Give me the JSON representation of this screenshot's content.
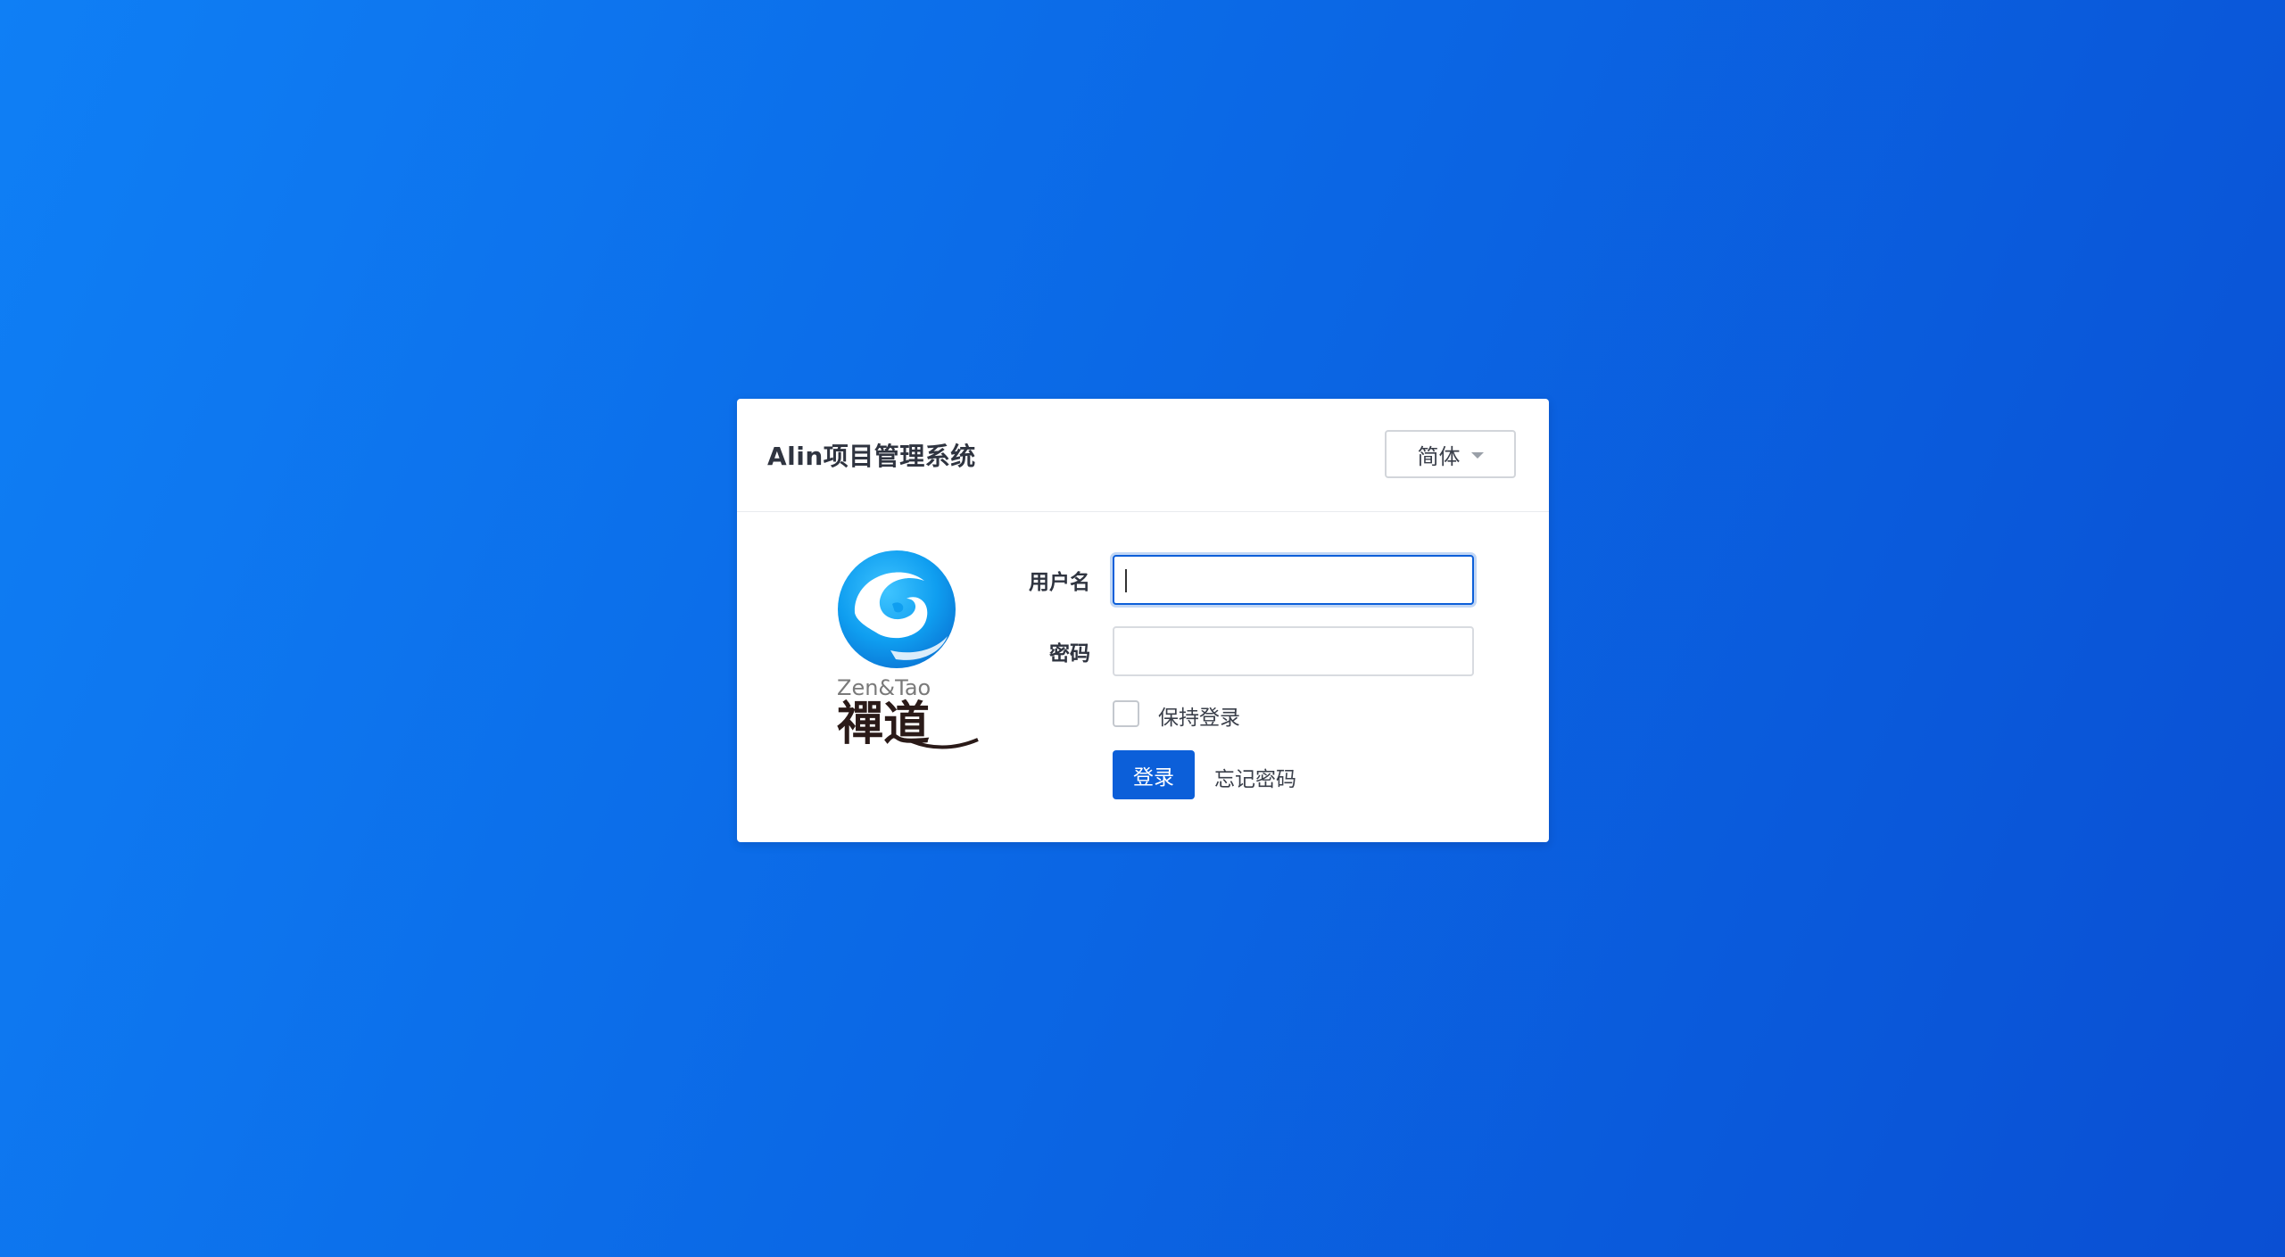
{
  "login_panel": {
    "title": "Alin项目管理系统",
    "language_selector": {
      "selected": "简体",
      "icon": "caret-down-icon"
    },
    "logo": {
      "text_latin": "Zen&Tao",
      "text_chinese": "禪道"
    },
    "username": {
      "label": "用户名",
      "value": "",
      "focused": true
    },
    "password": {
      "label": "密码",
      "value": ""
    },
    "keep_login": {
      "label": "保持登录",
      "checked": false
    },
    "login_button": "登录",
    "forgot_password": "忘记密码"
  },
  "colors": {
    "background_start": "#0f7ff5",
    "background_end": "#0a4fd3",
    "primary": "#0c5fd9",
    "panel": "#ffffff",
    "title_text": "#2f3440"
  }
}
